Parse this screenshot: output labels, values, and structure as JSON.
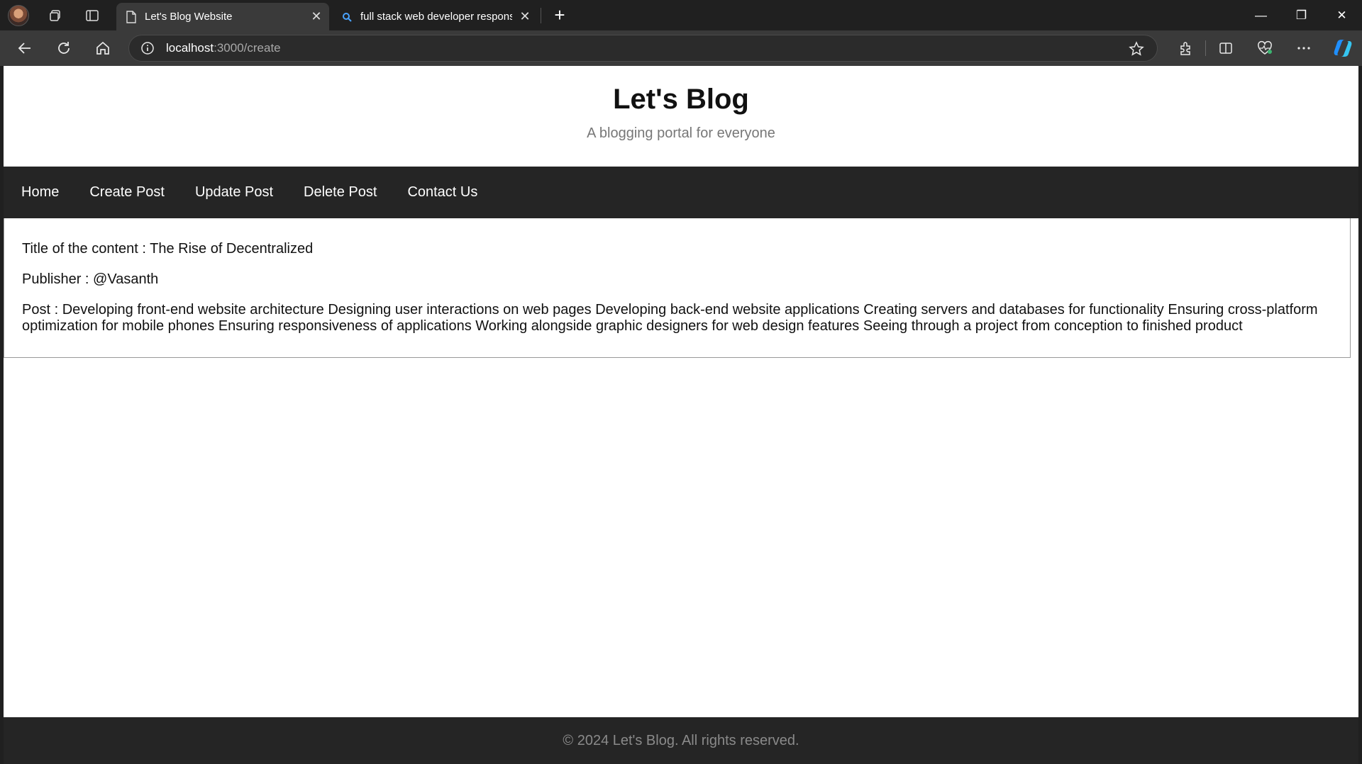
{
  "browser": {
    "tabs": [
      {
        "label": "Let's Blog Website",
        "active": true
      },
      {
        "label": "full stack web developer responsibilities",
        "active": false
      }
    ],
    "address": {
      "host": "localhost",
      "path": ":3000/create"
    },
    "icons": [
      "profile-avatar",
      "workspaces-icon",
      "tab-actions-icon",
      "page-icon",
      "search-icon",
      "close-icon",
      "plus-icon",
      "minimize-icon",
      "restore-icon",
      "back-icon",
      "refresh-icon",
      "home-icon",
      "info-icon",
      "star-icon",
      "extensions-icon",
      "split-screen-icon",
      "health-icon",
      "more-icon",
      "copilot-icon"
    ]
  },
  "site": {
    "title": "Let's Blog",
    "subtitle": "A blogging portal for everyone",
    "nav": [
      "Home",
      "Create Post",
      "Update Post",
      "Delete Post",
      "Contact Us"
    ]
  },
  "post": {
    "title_line": "Title of the content : The Rise of Decentralized",
    "publisher_line": "Publisher : @Vasanth",
    "body_line": "Post : Developing front-end website architecture Designing user interactions on web pages Developing back-end website applications Creating servers and databases for functionality Ensuring cross-platform optimization for mobile phones Ensuring responsiveness of applications Working alongside graphic designers for web design features Seeing through a project from conception to finished product"
  },
  "footer": {
    "text": "© 2024 Let's Blog. All rights reserved."
  }
}
